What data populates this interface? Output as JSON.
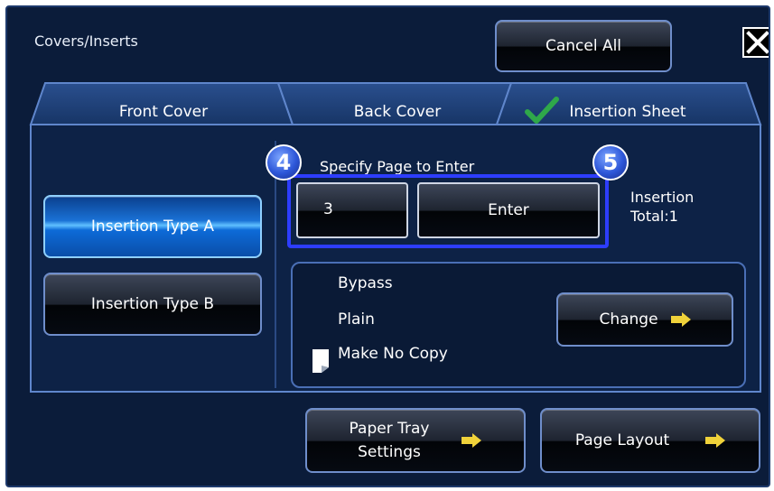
{
  "window": {
    "title": "Covers/Inserts"
  },
  "header": {
    "cancel_all_label": "Cancel All"
  },
  "tabs": [
    {
      "label": "Front Cover",
      "selected": false
    },
    {
      "label": "Back Cover",
      "selected": false
    },
    {
      "label": "Insertion Sheet",
      "selected": true,
      "icon": "check-icon"
    }
  ],
  "insertion_types": [
    {
      "label": "Insertion Type A",
      "selected": true
    },
    {
      "label": "Insertion Type B",
      "selected": false
    }
  ],
  "specify": {
    "label": "Specify Page to Enter",
    "page_value": "3",
    "enter_label": "Enter",
    "step_badges": [
      "4",
      "5"
    ]
  },
  "insertion_total": {
    "line1": "Insertion",
    "line2": "Total:1"
  },
  "paper": {
    "tray": "Bypass",
    "type": "Plain",
    "copy_option": "Make No Copy",
    "change_label": "Change"
  },
  "footer": {
    "paper_tray_line1": "Paper Tray",
    "paper_tray_line2": "Settings",
    "page_layout_label": "Page Layout"
  },
  "colors": {
    "background": "#0b1c3a",
    "highlight": "#2d3dff",
    "check": "#2fa84a",
    "arrow": "#f0d23a"
  }
}
